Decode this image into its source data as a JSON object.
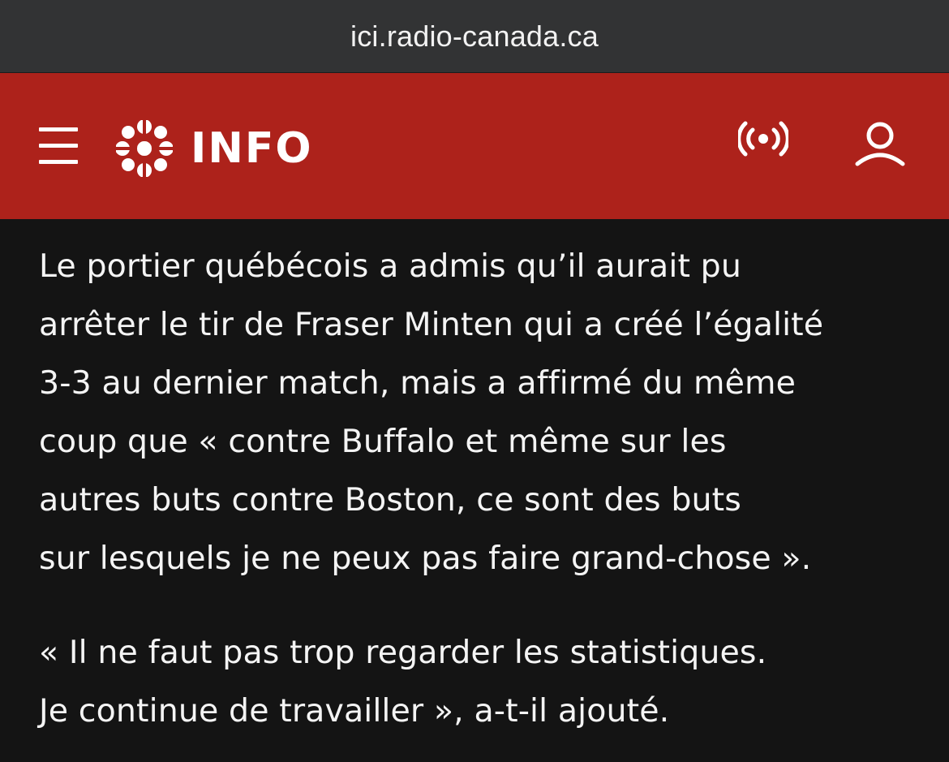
{
  "browser": {
    "url": "ici.radio-canada.ca"
  },
  "header": {
    "brand": "INFO",
    "icons": {
      "menu": "hamburger-menu-icon",
      "logo": "cbc-gem-logo-icon",
      "live": "live-broadcast-icon",
      "account": "user-account-icon"
    },
    "colors": {
      "background": "#ad221b",
      "foreground": "#ffffff"
    }
  },
  "article": {
    "paragraphs": [
      "Le portier québécois a admis qu’il aurait pu\narrêter le tir de Fraser Minten qui a créé l’égalité\n3-3 au dernier match, mais a affirmé du même\ncoup que « contre Buffalo et même sur les\nautres buts contre Boston, ce sont des buts\nsur lesquels je ne peux pas faire grand-chose ».",
      "« Il ne faut pas trop regarder les statistiques.\nJe continue de travailler », a-t-il ajouté."
    ]
  }
}
